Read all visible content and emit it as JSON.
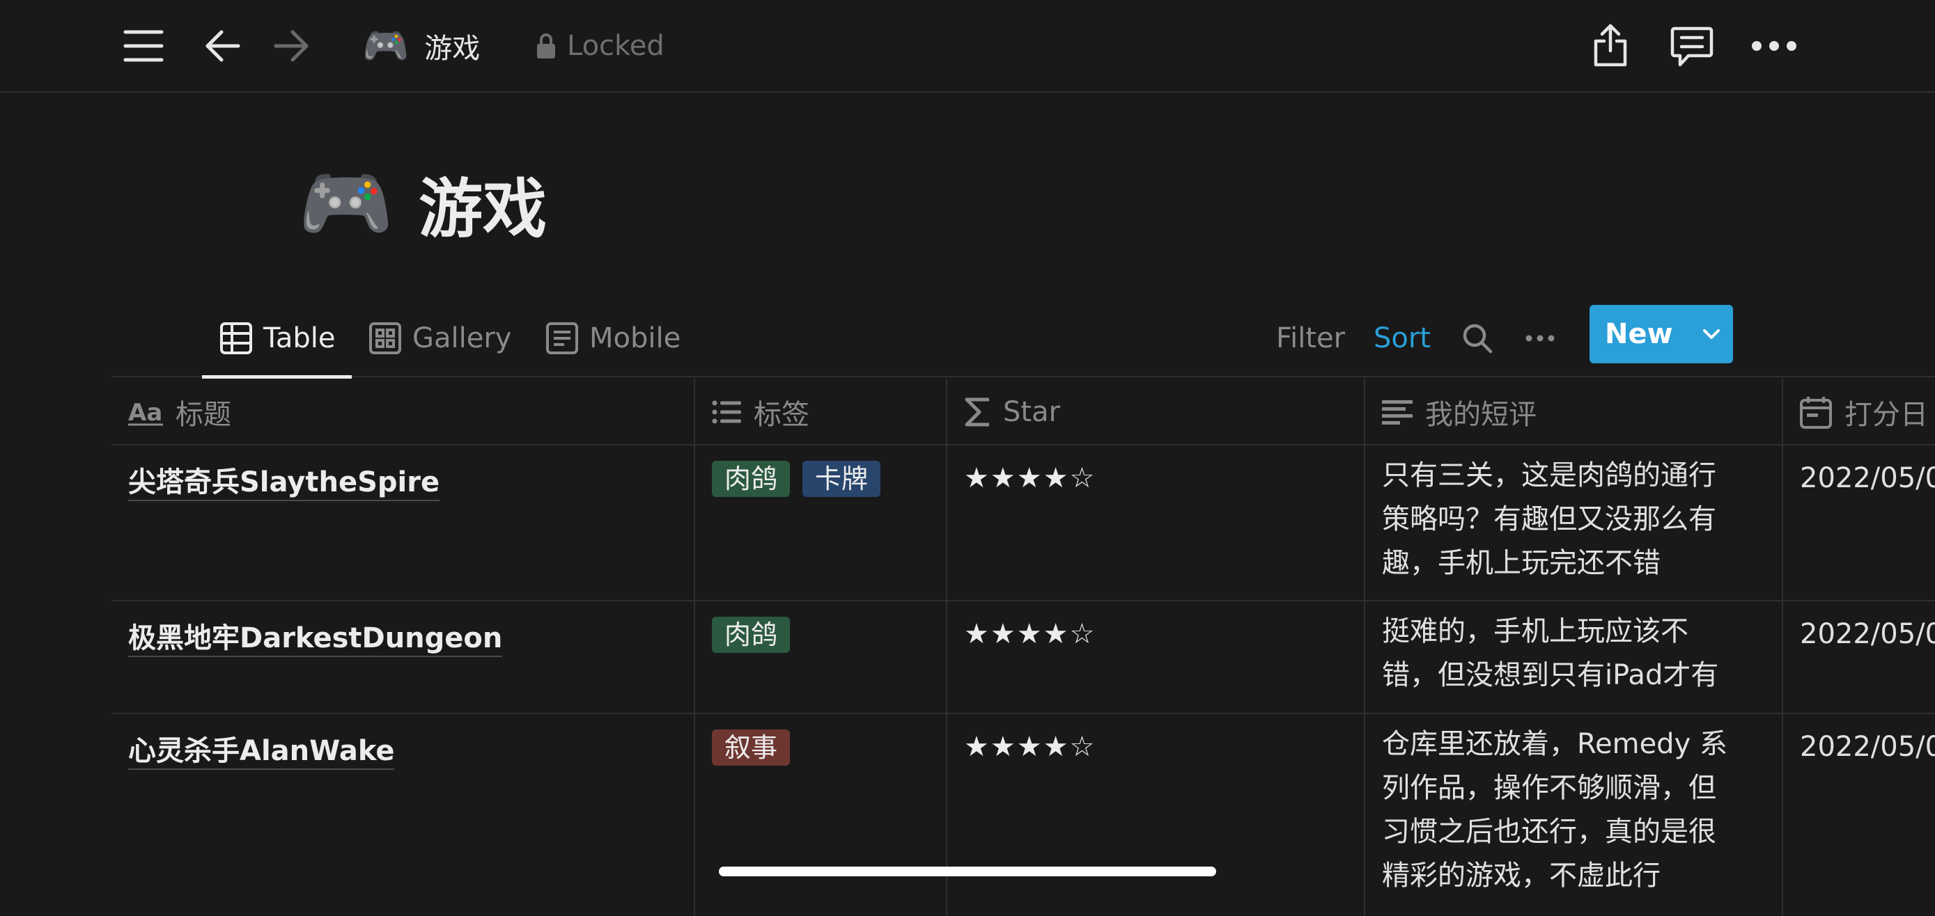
{
  "topbar": {
    "page_emoji": "🎮",
    "page_name": "游戏",
    "locked_label": "Locked"
  },
  "page": {
    "emoji": "🎮",
    "title": "游戏"
  },
  "viewbar": {
    "tabs": [
      {
        "label": "Table",
        "active": true
      },
      {
        "label": "Gallery",
        "active": false
      },
      {
        "label": "Mobile",
        "active": false
      }
    ],
    "filter_label": "Filter",
    "sort_label": "Sort",
    "new_label": "New",
    "colors": {
      "accent": "#2a9fd8",
      "sort": "#2a9fd8"
    }
  },
  "table": {
    "columns": [
      {
        "label": "标题",
        "icon": "text-type-icon"
      },
      {
        "label": "标签",
        "icon": "list-icon"
      },
      {
        "label": "Star",
        "icon": "sigma-icon"
      },
      {
        "label": "我的短评",
        "icon": "text-lines-icon"
      },
      {
        "label": "打分日",
        "icon": "calendar-icon"
      }
    ],
    "rows": [
      {
        "title": "尖塔奇兵SlaytheSpire",
        "tags": [
          {
            "label": "肉鸽",
            "color": "#2b593f"
          },
          {
            "label": "卡牌",
            "color": "#28456c"
          }
        ],
        "star": "★★★★☆",
        "review": [
          "只有三关，这是肉鸽的通行",
          "策略吗？有趣但又没那么有",
          "趣，手机上玩完还不错"
        ],
        "date": "2022/05/0"
      },
      {
        "title": "极黑地牢DarkestDungeon",
        "tags": [
          {
            "label": "肉鸽",
            "color": "#2b593f"
          }
        ],
        "star": "★★★★☆",
        "review": [
          "挺难的，手机上玩应该不",
          "错，但没想到只有iPad才有"
        ],
        "date": "2022/05/0"
      },
      {
        "title": "心灵杀手AlanWake",
        "tags": [
          {
            "label": "叙事",
            "color": "#6e3630"
          }
        ],
        "star": "★★★★☆",
        "review": [
          "仓库里还放着，Remedy 系",
          "列作品，操作不够顺滑，但",
          "习惯之后也还行，真的是很",
          "精彩的游戏，不虚此行"
        ],
        "date": "2022/05/0"
      }
    ]
  }
}
